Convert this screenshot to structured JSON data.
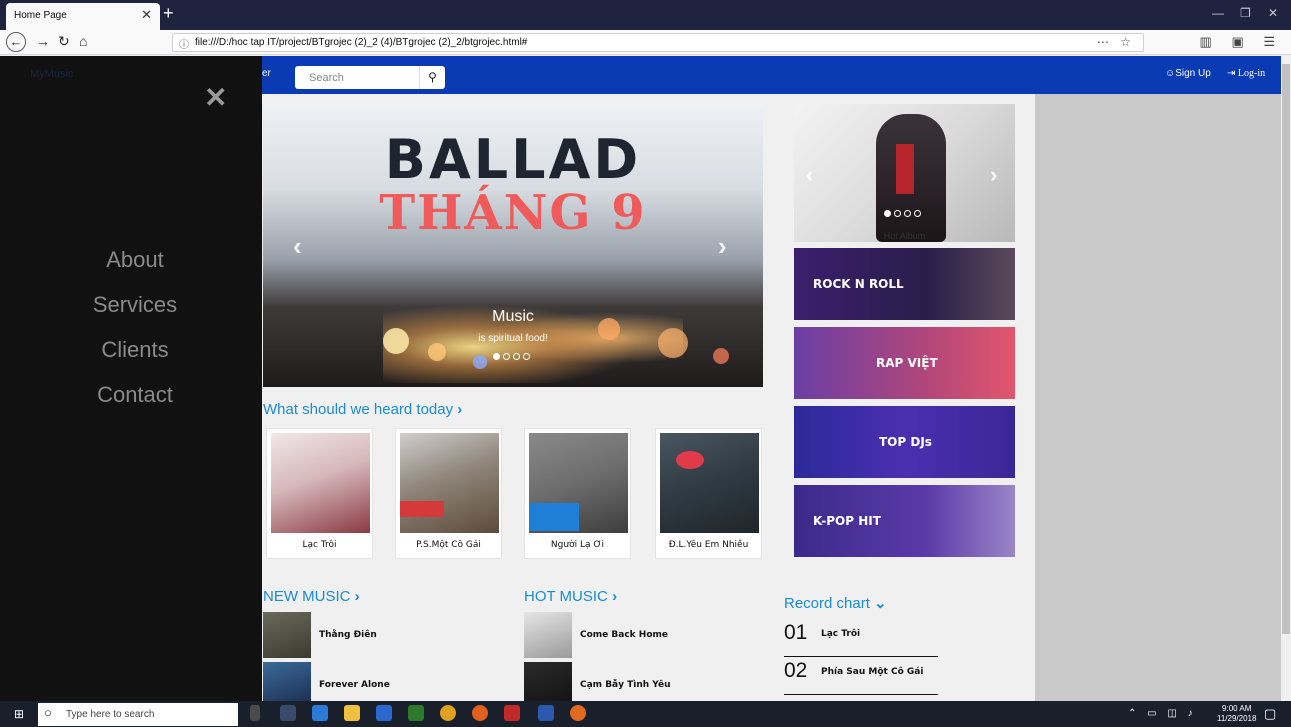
{
  "browser": {
    "tab_title": "Home Page",
    "url": "file:///D:/hoc tap IT/project/BTgrojec (2)_2 (4)/BTgrojec (2)_2/btgrojec.html#"
  },
  "site": {
    "nav_partial": "er",
    "search_placeholder": "Search",
    "signup": "Sign Up",
    "login": "Log-in"
  },
  "sidemenu": {
    "brand": "MyMusic",
    "items": [
      "About",
      "Services",
      "Clients",
      "Contact"
    ]
  },
  "carousel": {
    "headline": "BALLAD",
    "headline2": "THÁNG 9",
    "caption_title": "Music",
    "caption_text": "is spiritual food!"
  },
  "side": {
    "hot_album": "Hot Album",
    "genres": [
      "ROCK N ROLL",
      "RAP VIỆT",
      "TOP DJs",
      "K-POP HIT"
    ]
  },
  "sections": {
    "heard_today": "What should we heard today",
    "new_music": "NEW MUSIC",
    "hot_music": "HOT MUSIC",
    "record_chart": "Record chart"
  },
  "cards": [
    "Lạc Trôi",
    "P.S.Một Cô Gái",
    "Người Lạ Ơi",
    "Đ.L.Yêu Em Nhiều"
  ],
  "new_music": [
    "Thằng Điên",
    "Forever Alone"
  ],
  "hot_music": [
    "Come Back Home",
    "Cạm Bẫy Tình Yêu"
  ],
  "chart": [
    {
      "num": "01",
      "title": "Lạc Trôi"
    },
    {
      "num": "02",
      "title": "Phía Sau Một Cô Gái"
    }
  ],
  "taskbar": {
    "search_placeholder": "Type here to search",
    "time": "9:00 AM",
    "date": "11/29/2018"
  },
  "colors": {
    "site_nav": "#0a3bb5",
    "accent_link": "#1a8bd6",
    "sidemenu_bg": "#111111"
  }
}
